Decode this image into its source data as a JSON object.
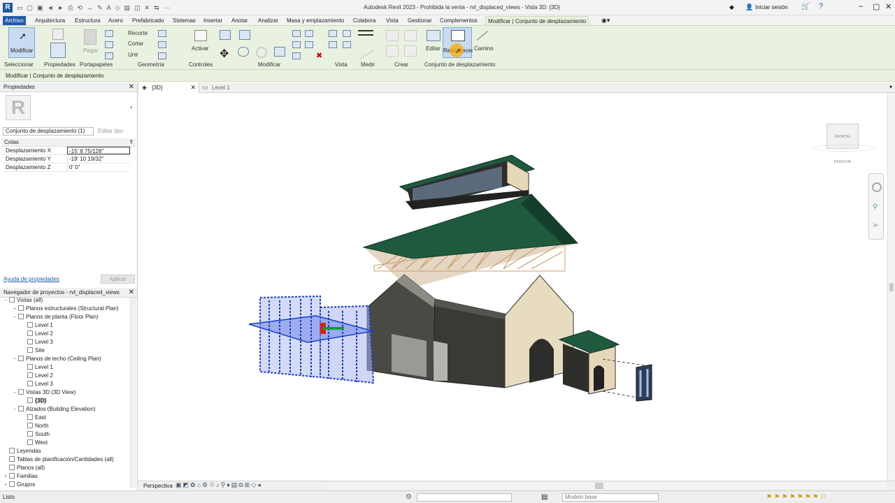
{
  "titlebar": {
    "title": "Autodesk Revit 2023 - Prohibida la venta - rvt_displaced_views - Vista 3D: {3D}",
    "sign_in": "Iniciar sesión"
  },
  "tabs": [
    "Archivo",
    "Arquitectura",
    "Estructura",
    "Acero",
    "Prefabricado",
    "Sistemas",
    "Insertar",
    "Anotar",
    "Analizar",
    "Masa y emplazamiento",
    "Colabora",
    "Vista",
    "Gestionar",
    "Complementos",
    "Modificar | Conjunto de desplazamiento"
  ],
  "ribbon": {
    "modificar": "Modificar",
    "seleccionar": "Seleccionar",
    "propiedades": "Propiedades",
    "pegar": "Pegar",
    "portapapeles": "Portapapeles",
    "recorte": "Recorte",
    "cortar": "Cortar",
    "unir": "Unir",
    "geometria": "Geometría",
    "activar": "Activar",
    "controles": "Controles",
    "modificar_panel": "Modificar",
    "vista": "Vista",
    "medir": "Medir",
    "crear": "Crear",
    "editar": "Editar",
    "restablecer": "Restablecer",
    "camino": "Camino",
    "conjunto": "Conjunto de desplazamiento"
  },
  "context_bar": "Modificar | Conjunto de desplazamiento",
  "properties": {
    "title": "Propiedades",
    "type_selector": "Conjunto de desplazamiento (1)",
    "edit_type": "Editar tipo",
    "section": "Cotas",
    "rows": [
      {
        "key": "Desplazamiento X",
        "value": "-15'  8 75/128\""
      },
      {
        "key": "Desplazamiento Y",
        "value": "-19'  10 19/32\""
      },
      {
        "key": "Desplazamiento Z",
        "value": "0'  0\""
      }
    ],
    "help_link": "Ayuda de propiedades",
    "apply": "Aplicar"
  },
  "browser": {
    "title": "Navegador de proyectos - rvt_displaced_views",
    "items": [
      {
        "label": "Vistas (all)",
        "level": 0,
        "exp": "−"
      },
      {
        "label": "Planos estructurales (Structural Plan)",
        "level": 1,
        "exp": "+"
      },
      {
        "label": "Planos de planta (Floor Plan)",
        "level": 1,
        "exp": "−"
      },
      {
        "label": "Level 1",
        "level": 2,
        "exp": ""
      },
      {
        "label": "Level 2",
        "level": 2,
        "exp": ""
      },
      {
        "label": "Level 3",
        "level": 2,
        "exp": ""
      },
      {
        "label": "Site",
        "level": 2,
        "exp": ""
      },
      {
        "label": "Planos de techo (Ceiling Plan)",
        "level": 1,
        "exp": "−"
      },
      {
        "label": "Level 1",
        "level": 2,
        "exp": ""
      },
      {
        "label": "Level 2",
        "level": 2,
        "exp": ""
      },
      {
        "label": "Level 3",
        "level": 2,
        "exp": ""
      },
      {
        "label": "Vistas 3D (3D View)",
        "level": 1,
        "exp": "−"
      },
      {
        "label": "{3D}",
        "level": 2,
        "exp": "",
        "bold": true
      },
      {
        "label": "Alzados (Building Elevation)",
        "level": 1,
        "exp": "−"
      },
      {
        "label": "East",
        "level": 2,
        "exp": ""
      },
      {
        "label": "North",
        "level": 2,
        "exp": ""
      },
      {
        "label": "South",
        "level": 2,
        "exp": ""
      },
      {
        "label": "West",
        "level": 2,
        "exp": ""
      },
      {
        "label": "Leyendas",
        "level": 0,
        "exp": ""
      },
      {
        "label": "Tablas de planificación/Cantidades (all)",
        "level": 0,
        "exp": ""
      },
      {
        "label": "Planos (all)",
        "level": 0,
        "exp": ""
      },
      {
        "label": "Familias",
        "level": 0,
        "exp": "+"
      },
      {
        "label": "Grupos",
        "level": 0,
        "exp": "+"
      }
    ]
  },
  "view_tabs": [
    {
      "label": "{3D}",
      "active": true
    },
    {
      "label": "Level 1",
      "active": false
    }
  ],
  "viewcube": {
    "front": "FRONTAL",
    "right": "DERECHA"
  },
  "view_control": {
    "mode": "Perspectiva"
  },
  "status": {
    "text": "Listo",
    "model": "Modelo base"
  },
  "colors": {
    "ribbon": "#e9f1e1",
    "roof": "#1f5a3e",
    "wall": "#3a3a35",
    "wall_light": "#e8dcc0",
    "selection": "#1a3ccc",
    "accent": "#1e5aa8"
  }
}
